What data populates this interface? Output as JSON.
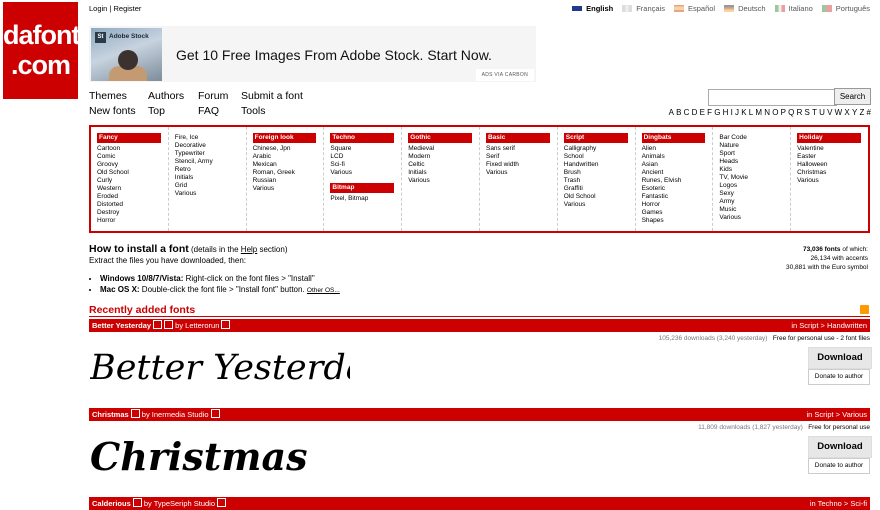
{
  "logo": {
    "line1": "dafont",
    "line2": ".com"
  },
  "topbar": {
    "login": "Login",
    "sep": "|",
    "register": "Register",
    "languages": [
      {
        "label": "English",
        "active": true,
        "flag": "flag-uk-icon"
      },
      {
        "label": "Français",
        "active": false,
        "flag": "flag-fr-icon"
      },
      {
        "label": "Español",
        "active": false,
        "flag": "flag-es-icon"
      },
      {
        "label": "Deutsch",
        "active": false,
        "flag": "flag-de-icon"
      },
      {
        "label": "Italiano",
        "active": false,
        "flag": "flag-it-icon"
      },
      {
        "label": "Português",
        "active": false,
        "flag": "flag-pt-icon"
      }
    ]
  },
  "ad": {
    "badge": "St",
    "brand": "Adobe Stock",
    "headline": "Get 10 Free Images From Adobe Stock. Start Now.",
    "via": "ADS VIA CARBON"
  },
  "nav": {
    "themes": "Themes",
    "authors": "Authors",
    "forum": "Forum",
    "submit": "Submit a font",
    "new_fonts": "New fonts",
    "top": "Top",
    "faq": "FAQ",
    "tools": "Tools"
  },
  "search": {
    "placeholder": "",
    "button": "Search"
  },
  "alphabet": [
    "A",
    "B",
    "C",
    "D",
    "E",
    "F",
    "G",
    "H",
    "I",
    "J",
    "K",
    "L",
    "M",
    "N",
    "O",
    "P",
    "Q",
    "R",
    "S",
    "T",
    "U",
    "V",
    "W",
    "X",
    "Y",
    "Z",
    "#"
  ],
  "categories": {
    "fancy": {
      "title": "Fancy",
      "items": [
        "Cartoon",
        "Comic",
        "Groovy",
        "Old School",
        "Curly",
        "Western",
        "Eroded",
        "Distorted",
        "Destroy",
        "Horror"
      ]
    },
    "fancy2": {
      "items": [
        "Fire, Ice",
        "Decorative",
        "Typewriter",
        "Stencil, Army",
        "Retro",
        "Initials",
        "Grid",
        "Various"
      ]
    },
    "foreign": {
      "title": "Foreign look",
      "items": [
        "Chinese, Jpn",
        "Arabic",
        "Mexican",
        "Roman, Greek",
        "Russian",
        "Various"
      ]
    },
    "techno": {
      "title": "Techno",
      "items": [
        "Square",
        "LCD",
        "Sci-fi",
        "Various"
      ]
    },
    "bitmap": {
      "title": "Bitmap",
      "items": [
        "Pixel, Bitmap"
      ]
    },
    "gothic": {
      "title": "Gothic",
      "items": [
        "Medieval",
        "Modern",
        "Celtic",
        "Initials",
        "Various"
      ]
    },
    "basic": {
      "title": "Basic",
      "items": [
        "Sans serif",
        "Serif",
        "Fixed width",
        "Various"
      ]
    },
    "script": {
      "title": "Script",
      "items": [
        "Calligraphy",
        "School",
        "Handwritten",
        "Brush",
        "Trash",
        "Graffiti",
        "Old School",
        "Various"
      ]
    },
    "dingbats": {
      "title": "Dingbats",
      "items": [
        "Alien",
        "Animals",
        "Asian",
        "Ancient",
        "Runes, Elvish",
        "Esoteric",
        "Fantastic",
        "Horror",
        "Games",
        "Shapes"
      ]
    },
    "dingbats2": {
      "items": [
        "Bar Code",
        "Nature",
        "Sport",
        "Heads",
        "Kids",
        "TV, Movie",
        "Logos",
        "Sexy",
        "Army",
        "Music",
        "Various"
      ]
    },
    "holiday": {
      "title": "Holiday",
      "items": [
        "Valentine",
        "Easter",
        "Halloween",
        "Christmas",
        "Various"
      ]
    }
  },
  "howto": {
    "title": "How to install a font",
    "details_pre": "(details in the ",
    "details_link": "Help",
    "details_post": " section)",
    "intro": "Extract the files you have downloaded, then:",
    "win_label": "Windows 10/8/7/Vista:",
    "win_text": " Right-click on the font files > \"Install\"",
    "mac_label": "Mac OS X:",
    "mac_text": " Double-click the font file > \"Install font\" button.",
    "other_os": "Other OS..."
  },
  "stats": {
    "total": "73,036 fonts",
    "total_suffix": " of which:",
    "accents": "26,134 with accents",
    "euro": "30,881 with the Euro symbol"
  },
  "recent": {
    "title": "Recently added fonts"
  },
  "fonts": [
    {
      "name": "Better Yesterday",
      "by": "by",
      "author": "Letterorun",
      "category": "in Script > Handwritten",
      "downloads": "105,236 downloads (3,240 yesterday)",
      "license": "Free for personal use - 2 font files",
      "sample": "Better Yesterday",
      "download": "Download",
      "donate": "Donate to author"
    },
    {
      "name": "Christmas",
      "by": "by",
      "author": "Inermedia Studio",
      "category": "in Script > Various",
      "downloads": "11,809 downloads (1,827 yesterday)",
      "license": "Free for personal use",
      "sample": "Christmas",
      "download": "Download",
      "donate": "Donate to author"
    },
    {
      "name": "Calderious",
      "by": "by",
      "author": "TypeSeriph Studio",
      "category": "in Techno > Sci-fi"
    }
  ],
  "colors": {
    "brand_red": "#cc0000"
  }
}
